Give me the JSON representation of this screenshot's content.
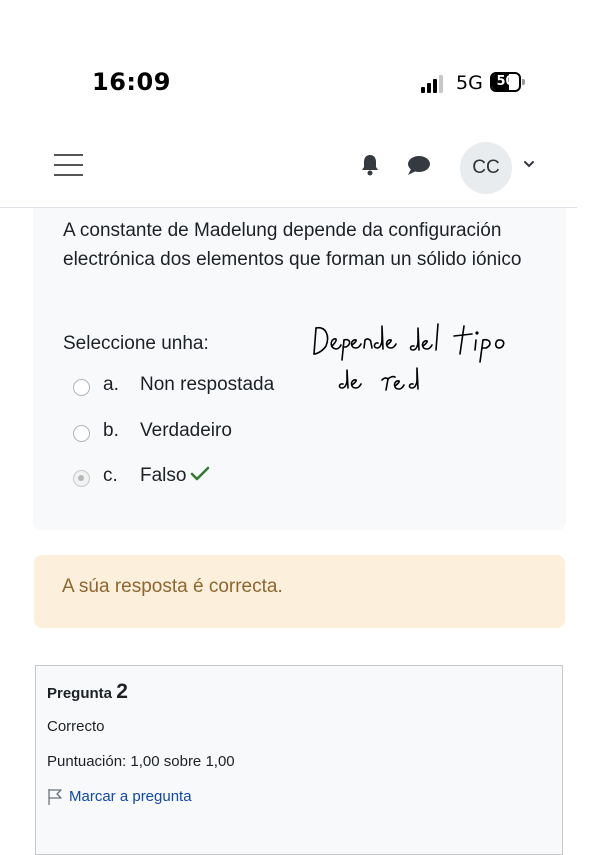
{
  "status_bar": {
    "time": "16:09",
    "network": "5G",
    "battery": "50"
  },
  "navbar": {
    "avatar_initials": "CC"
  },
  "question": {
    "text": "A constante de Madelung depende da configuración electrónica dos elementos que forman un sólido iónico",
    "prompt": "Seleccione unha:",
    "options": [
      {
        "letter": "a.",
        "label": "Non respostada",
        "selected": false
      },
      {
        "letter": "b.",
        "label": "Verdadeiro",
        "selected": false
      },
      {
        "letter": "c.",
        "label": "Falso",
        "selected": true,
        "correct": true
      }
    ],
    "handwritten_note": "Depende del tipo de red"
  },
  "feedback": {
    "text": "A súa resposta é correcta."
  },
  "question2": {
    "title_prefix": "Pregunta",
    "number": "2",
    "state": "Correcto",
    "grade": "Puntuación: 1,00 sobre 1,00",
    "flag_label": "Marcar a pregunta"
  },
  "colors": {
    "feedback_bg": "#fcefdc",
    "feedback_text": "#8e662e",
    "correct_check": "#357a32",
    "link": "#0f47ad"
  }
}
